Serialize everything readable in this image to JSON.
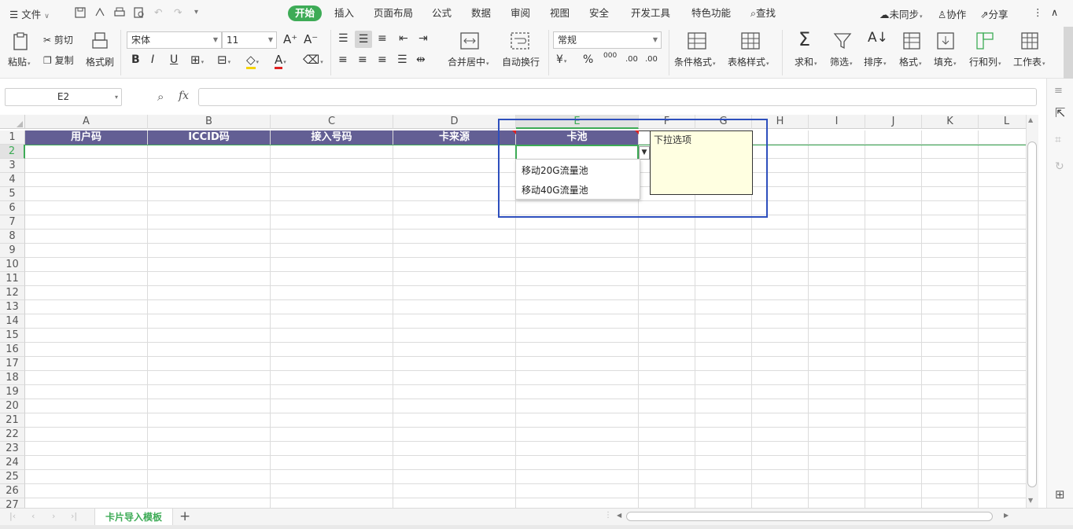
{
  "menubar": {
    "file_label": "文件",
    "tabs": [
      "开始",
      "插入",
      "页面布局",
      "公式",
      "数据",
      "审阅",
      "视图",
      "安全",
      "开发工具",
      "特色功能"
    ],
    "search_label": "查找",
    "sync_label": "未同步",
    "collab_label": "协作",
    "share_label": "分享"
  },
  "ribbon": {
    "paste": "粘贴",
    "cut": "剪切",
    "copy": "复制",
    "format_painter": "格式刷",
    "font_name": "宋体",
    "font_size": "11",
    "bold": "B",
    "italic": "I",
    "underline": "U",
    "merge_center": "合并居中",
    "wrap_text": "自动换行",
    "number_format": "常规",
    "percent": "%",
    "thousands": "000",
    "inc_decimal": ".00",
    "dec_decimal": ".00",
    "conditional_format": "条件格式",
    "table_style": "表格样式",
    "sum": "求和",
    "filter": "筛选",
    "sort": "排序",
    "format": "格式",
    "fill": "填充",
    "row_col": "行和列",
    "worksheet": "工作表"
  },
  "formula": {
    "namebox": "E2",
    "fx": "fx"
  },
  "grid": {
    "columns": [
      "A",
      "B",
      "C",
      "D",
      "E",
      "F",
      "G",
      "H",
      "I",
      "J",
      "K",
      "L"
    ],
    "headers": [
      "用户码",
      "ICCID码",
      "接入号码",
      "卡来源",
      "卡池"
    ],
    "rows": [
      "1",
      "2",
      "3",
      "4",
      "5",
      "6",
      "7",
      "8",
      "9",
      "10",
      "11",
      "12",
      "13",
      "14",
      "15",
      "16",
      "17",
      "18",
      "19",
      "20",
      "21",
      "22",
      "23",
      "24",
      "25",
      "26",
      "27"
    ]
  },
  "dropdown": {
    "options": [
      "移动20G流量池",
      "移动40G流量池"
    ]
  },
  "tooltip": {
    "text": "下拉选项"
  },
  "sheets": {
    "active": "卡片导入模板",
    "add": "+"
  },
  "colors": {
    "accent": "#3dab56",
    "header_fill": "#635f94",
    "highlight": "#2e4fbd",
    "tooltip_bg": "#ffffe1"
  }
}
